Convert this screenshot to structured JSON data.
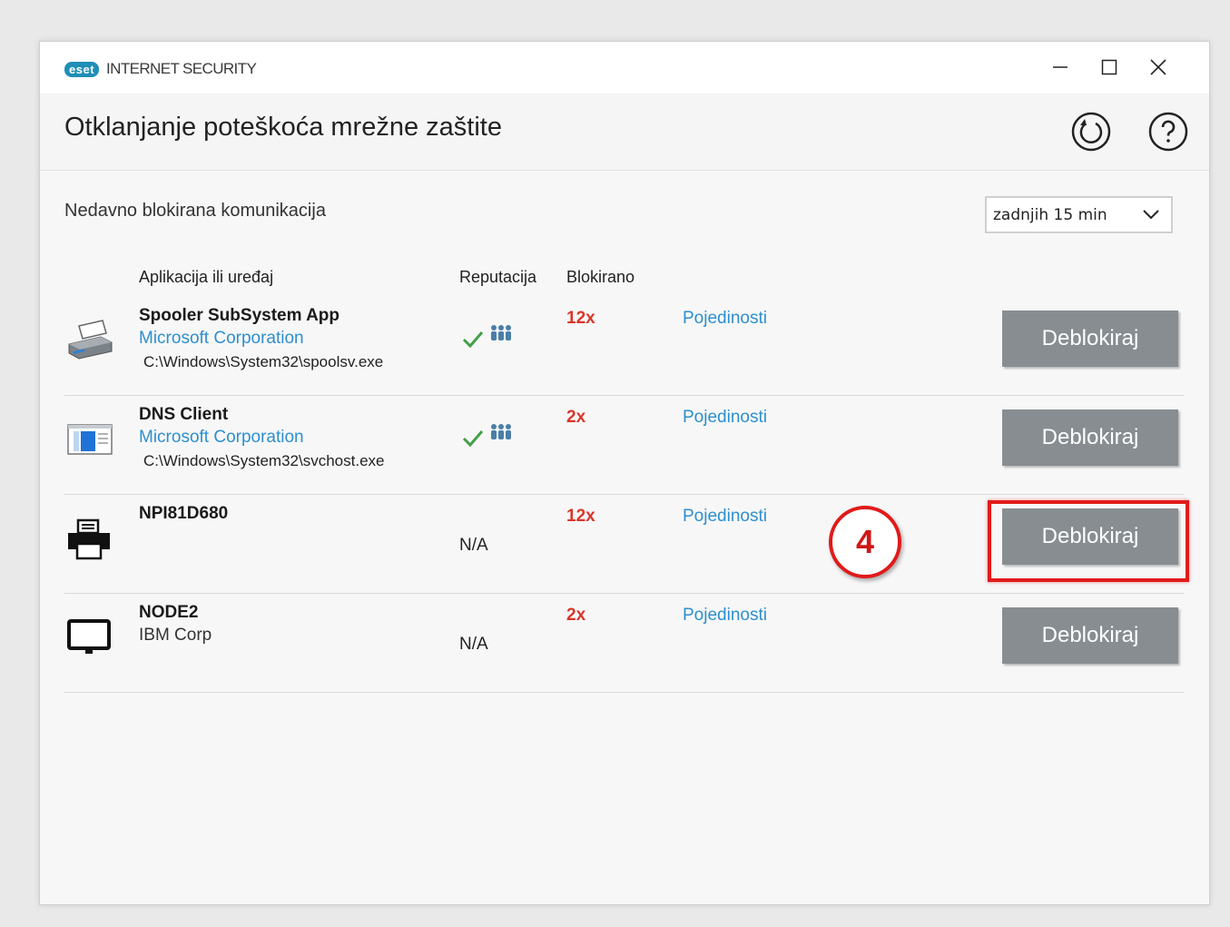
{
  "window": {
    "brand_logo": "eset",
    "product_name": "INTERNET SECURITY",
    "controls": [
      "minimize-icon",
      "maximize-icon",
      "close-icon"
    ]
  },
  "header": {
    "title": "Otklanjanje poteškoća mrežne zaštite",
    "icons": [
      "refresh-icon",
      "help-icon"
    ]
  },
  "section": {
    "label": "Nedavno blokirana komunikacija",
    "time_filter": "zadnjih 15 min"
  },
  "columns": {
    "app": "Aplikacija ili uređaj",
    "reputation": "Reputacija",
    "blocked": "Blokirano"
  },
  "rows": [
    {
      "name": "Spooler SubSystem App",
      "vendor": "Microsoft Corporation",
      "path": "C:\\Windows\\System32\\spoolsv.exe",
      "reputation": "check-users-icon",
      "count": "12x",
      "details": "Pojedinosti",
      "action": "Deblokiraj"
    },
    {
      "name": "DNS Client",
      "vendor": "Microsoft Corporation",
      "path": "C:\\Windows\\System32\\svchost.exe",
      "reputation": "check-users-icon",
      "count": "2x",
      "details": "Pojedinosti",
      "action": "Deblokiraj"
    },
    {
      "name": "NPI81D680",
      "reputation": "N/A",
      "count": "12x",
      "details": "Pojedinosti",
      "action": "Deblokiraj"
    },
    {
      "name": "NODE2",
      "vendor": "IBM Corp",
      "reputation": "N/A",
      "count": "2x",
      "details": "Pojedinosti",
      "action": "Deblokiraj"
    }
  ],
  "annotation": {
    "step": "4",
    "color": "#e11a1a"
  },
  "colors": {
    "link": "#2d8fce",
    "count": "#d9362a",
    "button": "#878d91",
    "brand": "#1f8fb6"
  }
}
